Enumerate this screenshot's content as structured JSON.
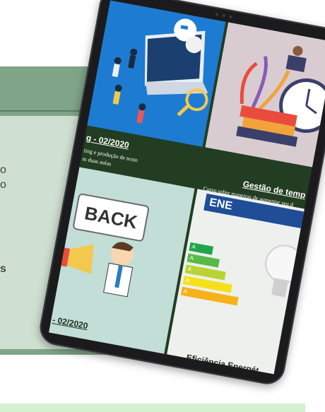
{
  "side_text": {
    "line1_fragment": "o",
    "line2_fragment": "o",
    "line3_fragment": "s"
  },
  "cards": [
    {
      "title": "g - 02/2020",
      "desc_line1": "ting e produção de texto",
      "desc_line2": "m duas aulas"
    },
    {
      "title": "Gestão de temp",
      "desc_line1": "Curso sobre maneiras de aumentar seu d"
    },
    {
      "title": "- 02/2020",
      "illustration_text": "BACK"
    },
    {
      "title": "Eficiência Energét",
      "illustration_text": "ENE"
    }
  ],
  "energy_labels": [
    "A",
    "A",
    "A",
    "A",
    "A"
  ]
}
